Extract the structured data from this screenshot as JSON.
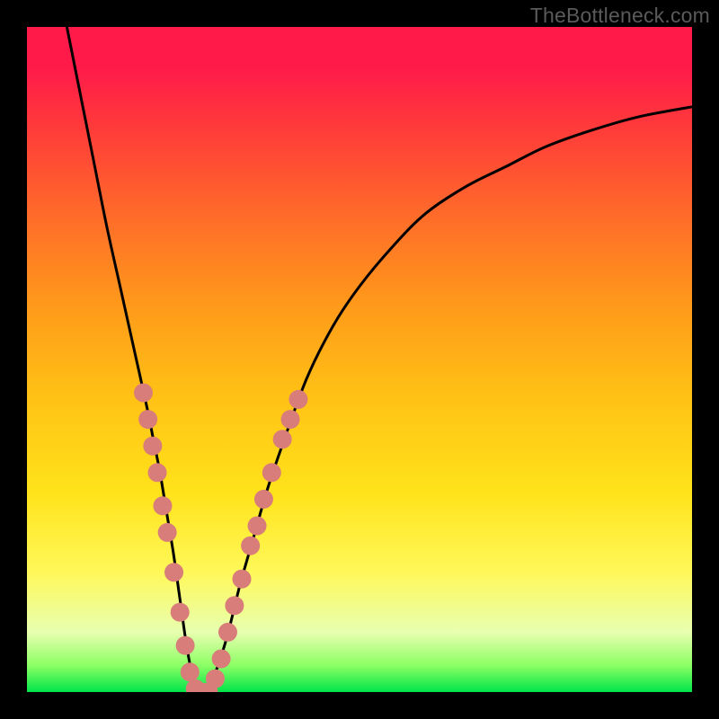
{
  "watermark": "TheBottleneck.com",
  "colors": {
    "background": "#000000",
    "curve": "#000000",
    "dot_fill": "#d97d7a",
    "dot_stroke": "#b55a57",
    "gradient_top": "#ff1a4a",
    "gradient_bottom": "#00e54a"
  },
  "chart_data": {
    "type": "line",
    "title": "",
    "xlabel": "",
    "ylabel": "",
    "xlim": [
      0,
      100
    ],
    "ylim": [
      0,
      100
    ],
    "series": [
      {
        "name": "curve",
        "x": [
          6,
          8,
          10,
          12,
          14,
          16,
          18,
          19,
          20,
          21,
          22,
          23,
          24,
          25,
          26,
          27,
          28,
          30,
          32,
          34,
          36,
          38,
          42,
          46,
          50,
          55,
          60,
          66,
          72,
          78,
          85,
          92,
          100
        ],
        "values": [
          100,
          90,
          80,
          70,
          61,
          52,
          43,
          38,
          33,
          27,
          21,
          14,
          7,
          2,
          0,
          0,
          2,
          8,
          16,
          23,
          30,
          36,
          47,
          55,
          61,
          67,
          72,
          76,
          79,
          82,
          84.5,
          86.5,
          88
        ]
      }
    ],
    "dots_left": [
      {
        "x": 17.5,
        "y": 45
      },
      {
        "x": 18.2,
        "y": 41
      },
      {
        "x": 18.9,
        "y": 37
      },
      {
        "x": 19.6,
        "y": 33
      },
      {
        "x": 20.4,
        "y": 28
      },
      {
        "x": 21.1,
        "y": 24
      },
      {
        "x": 22.1,
        "y": 18
      },
      {
        "x": 23.0,
        "y": 12
      },
      {
        "x": 23.8,
        "y": 7
      },
      {
        "x": 24.5,
        "y": 3
      },
      {
        "x": 25.3,
        "y": 0.5
      },
      {
        "x": 26.3,
        "y": 0
      },
      {
        "x": 27.3,
        "y": 0
      }
    ],
    "dots_right": [
      {
        "x": 28.3,
        "y": 2
      },
      {
        "x": 29.2,
        "y": 5
      },
      {
        "x": 30.2,
        "y": 9
      },
      {
        "x": 31.2,
        "y": 13
      },
      {
        "x": 32.3,
        "y": 17
      },
      {
        "x": 33.6,
        "y": 22
      },
      {
        "x": 34.6,
        "y": 25
      },
      {
        "x": 35.6,
        "y": 29
      },
      {
        "x": 36.8,
        "y": 33
      },
      {
        "x": 38.4,
        "y": 38
      },
      {
        "x": 39.6,
        "y": 41
      },
      {
        "x": 40.8,
        "y": 44
      }
    ]
  }
}
